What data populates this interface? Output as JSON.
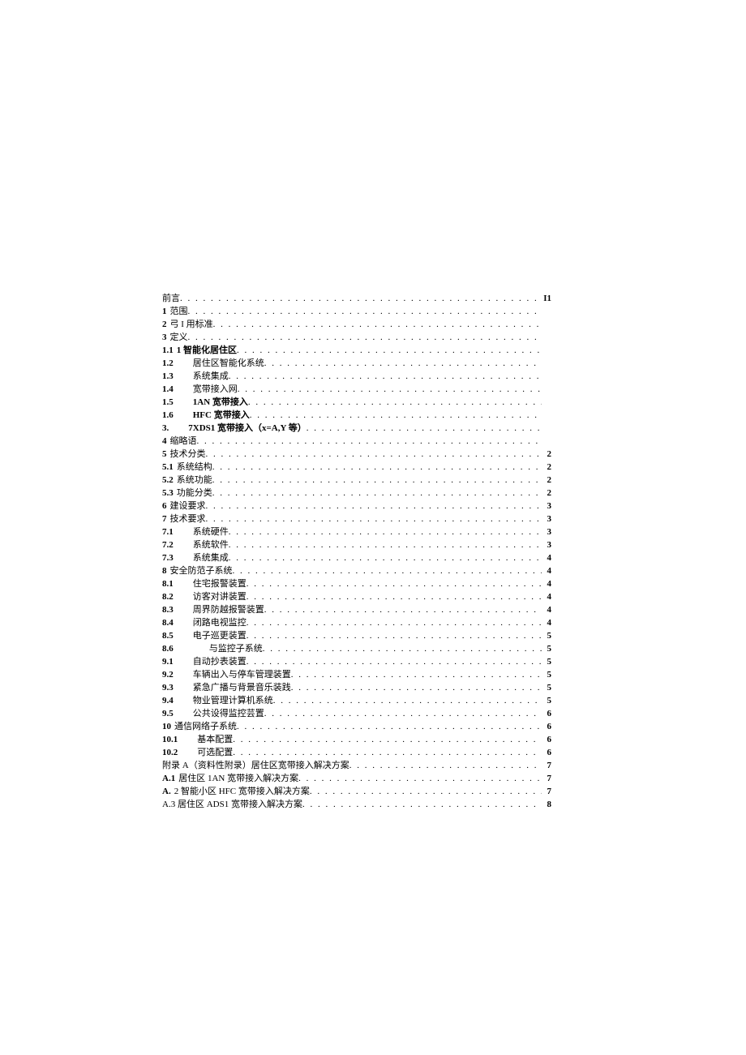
{
  "toc": [
    {
      "num": "",
      "title": "前言",
      "page": "I1",
      "indent": 0,
      "boldTitle": false
    },
    {
      "num": "1",
      "title": "范围",
      "page": "",
      "indent": 0,
      "boldTitle": false
    },
    {
      "num": "2",
      "title": "弓 I 用标准",
      "page": "",
      "indent": 0,
      "boldTitle": false
    },
    {
      "num": "3",
      "title": "定义",
      "page": "",
      "indent": 0,
      "boldTitle": false
    },
    {
      "num": "1.1",
      "title": "1 智能化居住区",
      "page": "",
      "indent": 0,
      "boldTitle": true
    },
    {
      "num": "1.2",
      "title": "居住区智能化系统",
      "page": "",
      "indent": 1,
      "boldTitle": false
    },
    {
      "num": "1.3",
      "title": "系统集成",
      "page": "",
      "indent": 1,
      "boldTitle": false
    },
    {
      "num": "1.4",
      "title": "宽带接入网",
      "page": "",
      "indent": 1,
      "boldTitle": false
    },
    {
      "num": "1.5",
      "title": "1AN 宽带接入",
      "page": "",
      "indent": 1,
      "boldTitle": true
    },
    {
      "num": "1.6",
      "title": "HFC 宽带接入",
      "page": "",
      "indent": 1,
      "boldTitle": true
    },
    {
      "num": "3.",
      "title": "7XDS1 宽带接入（x=A,Y 等）",
      "page": "",
      "indent": 1,
      "boldTitle": true
    },
    {
      "num": "4",
      "title": "缩略语",
      "page": "",
      "indent": 0,
      "boldTitle": false
    },
    {
      "num": "5",
      "title": "技术分类",
      "page": "2",
      "indent": 0,
      "boldTitle": false
    },
    {
      "num": "5.1",
      "title": "系统结构",
      "page": "2",
      "indent": 0,
      "boldTitle": false
    },
    {
      "num": "5.2",
      "title": "系统功能",
      "page": "2",
      "indent": 0,
      "boldTitle": false
    },
    {
      "num": "5.3",
      "title": "功能分类",
      "page": "2",
      "indent": 0,
      "boldTitle": false
    },
    {
      "num": "6",
      "title": "建设要求",
      "page": "3",
      "indent": 0,
      "boldTitle": false
    },
    {
      "num": "7",
      "title": "技术要求",
      "page": "3",
      "indent": 0,
      "boldTitle": false
    },
    {
      "num": "7.1",
      "title": "系统硬件",
      "page": "3",
      "indent": 1,
      "boldTitle": false
    },
    {
      "num": "7.2",
      "title": "系统软件",
      "page": "3",
      "indent": 1,
      "boldTitle": false
    },
    {
      "num": "7.3",
      "title": "系统集成",
      "page": "4",
      "indent": 1,
      "boldTitle": false
    },
    {
      "num": "8",
      "title": "安全防范子系统",
      "page": "4",
      "indent": 0,
      "boldTitle": false
    },
    {
      "num": "8.1",
      "title": "住宅报警装置",
      "page": "4",
      "indent": 1,
      "boldTitle": false
    },
    {
      "num": "8.2",
      "title": "访客对讲装置",
      "page": "4",
      "indent": 1,
      "boldTitle": false
    },
    {
      "num": "8.3",
      "title": "周界防越报警装置",
      "page": "4",
      "indent": 1,
      "boldTitle": false
    },
    {
      "num": "8.4",
      "title": "闭路电视监控",
      "page": "4",
      "indent": 1,
      "boldTitle": false
    },
    {
      "num": "8.5",
      "title": "电子巡更装置",
      "page": "5",
      "indent": 1,
      "boldTitle": false
    },
    {
      "num": "8.6",
      "title": "与监控子系统",
      "page": "5",
      "indent": 2,
      "boldTitle": false
    },
    {
      "num": "9.1",
      "title": "自动抄表装置",
      "page": "5",
      "indent": 1,
      "boldTitle": false
    },
    {
      "num": "9.2",
      "title": "车辆出入与停车管理装置",
      "page": "5",
      "indent": 1,
      "boldTitle": false
    },
    {
      "num": "9.3",
      "title": "紧急广播与背景音乐装践",
      "page": "5",
      "indent": 1,
      "boldTitle": false
    },
    {
      "num": "9.4",
      "title": "物业管理计算机系统",
      "page": "5",
      "indent": 1,
      "boldTitle": false
    },
    {
      "num": "9.5",
      "title": "公共设得监控芸置",
      "page": "6",
      "indent": 1,
      "boldTitle": false
    },
    {
      "num": "10",
      "title": "通信网络子系统",
      "page": "6",
      "indent": 0,
      "boldTitle": false
    },
    {
      "num": "10.1",
      "title": "基本配置",
      "page": "6",
      "indent": 1,
      "boldTitle": false
    },
    {
      "num": "10.2",
      "title": "可选配置",
      "page": "6",
      "indent": 1,
      "boldTitle": false
    },
    {
      "num": "",
      "title": "附录 A（资料性附录）居住区宽带接入解决方案",
      "page": "7",
      "indent": 0,
      "boldTitle": false,
      "mixedBold": "A"
    },
    {
      "num": "A.1",
      "title": "居住区 1AN 宽带接入解决方案",
      "page": "7",
      "indent": 0,
      "boldTitle": false,
      "mixedBold": "1AN"
    },
    {
      "num": "A.",
      "title": "2 智能小区 HFC 宽带接入解决方案",
      "page": "7",
      "indent": 0,
      "boldTitle": false,
      "mixedBold": "HFC"
    },
    {
      "num": "",
      "title": "A.3 居住区 ADS1 宽带接入解决方案",
      "page": "8",
      "indent": 0,
      "boldTitle": false
    }
  ]
}
